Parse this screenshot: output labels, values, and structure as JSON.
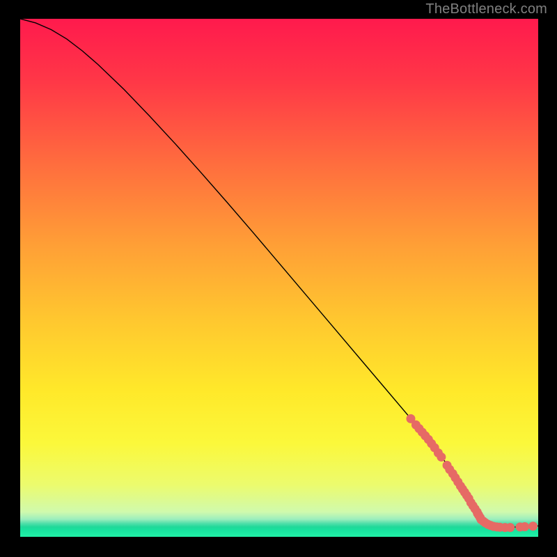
{
  "attribution": "TheBottleneck.com",
  "chart_data": {
    "type": "line",
    "title": "",
    "xlabel": "",
    "ylabel": "",
    "xlim": [
      0,
      100
    ],
    "ylim": [
      0,
      100
    ],
    "grid": false,
    "curve": {
      "name": "bottleneck-curve",
      "color": "#000000",
      "x": [
        0,
        3,
        6,
        9,
        12,
        15,
        20,
        25,
        30,
        35,
        40,
        45,
        50,
        55,
        60,
        65,
        70,
        75,
        80,
        85,
        87,
        88.5,
        90,
        92,
        94,
        96,
        98,
        100
      ],
      "y": [
        100,
        99.2,
        97.9,
        96.1,
        93.8,
        91.2,
        86.4,
        81.2,
        75.8,
        70.2,
        64.5,
        58.7,
        52.8,
        46.9,
        41.0,
        35.1,
        29.2,
        23.3,
        17.4,
        10.2,
        6.0,
        3.5,
        2.2,
        1.8,
        1.8,
        1.9,
        2.0,
        2.1
      ]
    },
    "highlighted_points": {
      "name": "highlighted-scatter",
      "color": "#e66a65",
      "radius": 6.5,
      "x": [
        75.4,
        76.4,
        77.0,
        77.6,
        78.2,
        78.8,
        79.4,
        80.0,
        80.7,
        81.3,
        82.4,
        82.9,
        83.5,
        84.0,
        84.5,
        85.0,
        85.4,
        85.8,
        86.2,
        86.6,
        87.0,
        87.4,
        87.8,
        88.2,
        88.5,
        88.8,
        88.3,
        89.0,
        89.4,
        89.8,
        90.3,
        90.8,
        91.4,
        92.0,
        92.6,
        93.6,
        94.6,
        96.5,
        97.4,
        99.0
      ],
      "y": [
        22.8,
        21.6,
        20.9,
        20.2,
        19.5,
        18.8,
        18.0,
        17.2,
        16.2,
        15.4,
        13.8,
        13.0,
        12.2,
        11.4,
        10.6,
        9.8,
        9.2,
        8.6,
        8.0,
        7.4,
        6.6,
        6.0,
        5.4,
        4.8,
        4.2,
        3.7,
        4.5,
        3.3,
        3.0,
        2.7,
        2.4,
        2.2,
        2.0,
        1.9,
        1.85,
        1.8,
        1.8,
        1.9,
        1.95,
        2.05
      ]
    },
    "background": {
      "type": "vertical-gradient",
      "stops": [
        {
          "offset": 0.0,
          "color": "#ff1a4d"
        },
        {
          "offset": 0.12,
          "color": "#ff3747"
        },
        {
          "offset": 0.28,
          "color": "#ff6d3e"
        },
        {
          "offset": 0.44,
          "color": "#ffa036"
        },
        {
          "offset": 0.58,
          "color": "#ffc72f"
        },
        {
          "offset": 0.72,
          "color": "#ffe92a"
        },
        {
          "offset": 0.82,
          "color": "#fbf83b"
        },
        {
          "offset": 0.9,
          "color": "#ecfb6e"
        },
        {
          "offset": 0.952,
          "color": "#d0faad"
        },
        {
          "offset": 0.966,
          "color": "#9ceebd"
        },
        {
          "offset": 0.974,
          "color": "#53dfaa"
        },
        {
          "offset": 0.981,
          "color": "#1fd999"
        },
        {
          "offset": 0.988,
          "color": "#18e49f"
        },
        {
          "offset": 1.0,
          "color": "#22f1a7"
        }
      ]
    }
  }
}
